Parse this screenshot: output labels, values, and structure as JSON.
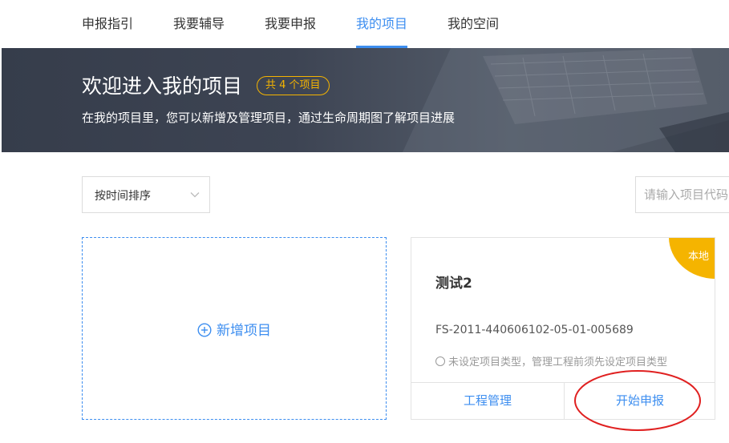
{
  "nav": {
    "items": [
      {
        "label": "申报指引"
      },
      {
        "label": "我要辅导"
      },
      {
        "label": "我要申报"
      },
      {
        "label": "我的项目",
        "active": true
      },
      {
        "label": "我的空间"
      }
    ]
  },
  "banner": {
    "title": "欢迎进入我的项目",
    "badge": "共 4 个项目",
    "subtitle": "在我的项目里，您可以新增及管理项目，通过生命周期图了解项目进展"
  },
  "toolbar": {
    "sort_label": "按时间排序",
    "search_placeholder": "请输入项目代码"
  },
  "add_card": {
    "label": "新增项目"
  },
  "project": {
    "badge": "本地",
    "name": "测试2",
    "code": "FS-2011-440606102-05-01-005689",
    "type_hint": "未设定项目类型，管理工程前须先设定项目类型",
    "actions": {
      "manage": "工程管理",
      "start": "开始申报"
    }
  },
  "colors": {
    "accent": "#3d8ef0",
    "badge": "#f5b400",
    "annotation": "#e02020"
  }
}
